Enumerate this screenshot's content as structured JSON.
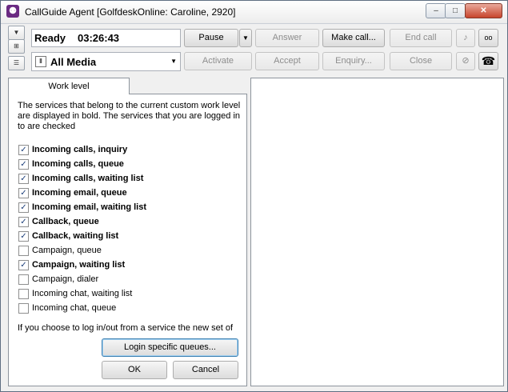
{
  "window": {
    "title": "CallGuide Agent [GolfdeskOnline: Caroline, 2920]",
    "controls": {
      "minimize": "–",
      "maximize": "□",
      "close": "✕"
    }
  },
  "side_icons": {
    "dropdown": "▼",
    "window_add": "⊞",
    "window_list": "☰"
  },
  "status": {
    "state": "Ready",
    "timer": "03:26:43"
  },
  "media": {
    "label": "All Media",
    "icon": "Ⅱ",
    "caret": "▼"
  },
  "toolbar": {
    "pause": "Pause",
    "pause_menu": "▼",
    "answer": "Answer",
    "make_call": "Make call...",
    "end_call": "End call",
    "activate": "Activate",
    "accept": "Accept",
    "enquiry": "Enquiry...",
    "close": "Close",
    "music_icon": "♪",
    "voicemail_icon": "ᴏᴏ",
    "mute_icon": "⊘",
    "phone_icon": "☎"
  },
  "work_level": {
    "tab_label": "Work level",
    "description": "The services that belong to the current custom work level are displayed in bold. The services that you are logged in to are checked",
    "services": [
      {
        "label": "Incoming calls, inquiry",
        "checked": true,
        "bold": true
      },
      {
        "label": "Incoming calls, queue",
        "checked": true,
        "bold": true
      },
      {
        "label": "Incoming calls, waiting list",
        "checked": true,
        "bold": true
      },
      {
        "label": "Incoming email, queue",
        "checked": true,
        "bold": true
      },
      {
        "label": "Incoming email, waiting list",
        "checked": true,
        "bold": true
      },
      {
        "label": "Callback, queue",
        "checked": true,
        "bold": true
      },
      {
        "label": "Callback, waiting list",
        "checked": true,
        "bold": true
      },
      {
        "label": "Campaign, queue",
        "checked": false,
        "bold": false
      },
      {
        "label": "Campaign, waiting list",
        "checked": true,
        "bold": true
      },
      {
        "label": "Campaign, dialer",
        "checked": false,
        "bold": false
      },
      {
        "label": "Incoming chat, waiting list",
        "checked": false,
        "bold": false
      },
      {
        "label": "Incoming chat, queue",
        "checked": false,
        "bold": false
      }
    ],
    "note": "If you choose to log in/out from a service the new set of",
    "login_button": "Login specific queues...",
    "ok_button": "OK",
    "cancel_button": "Cancel"
  }
}
